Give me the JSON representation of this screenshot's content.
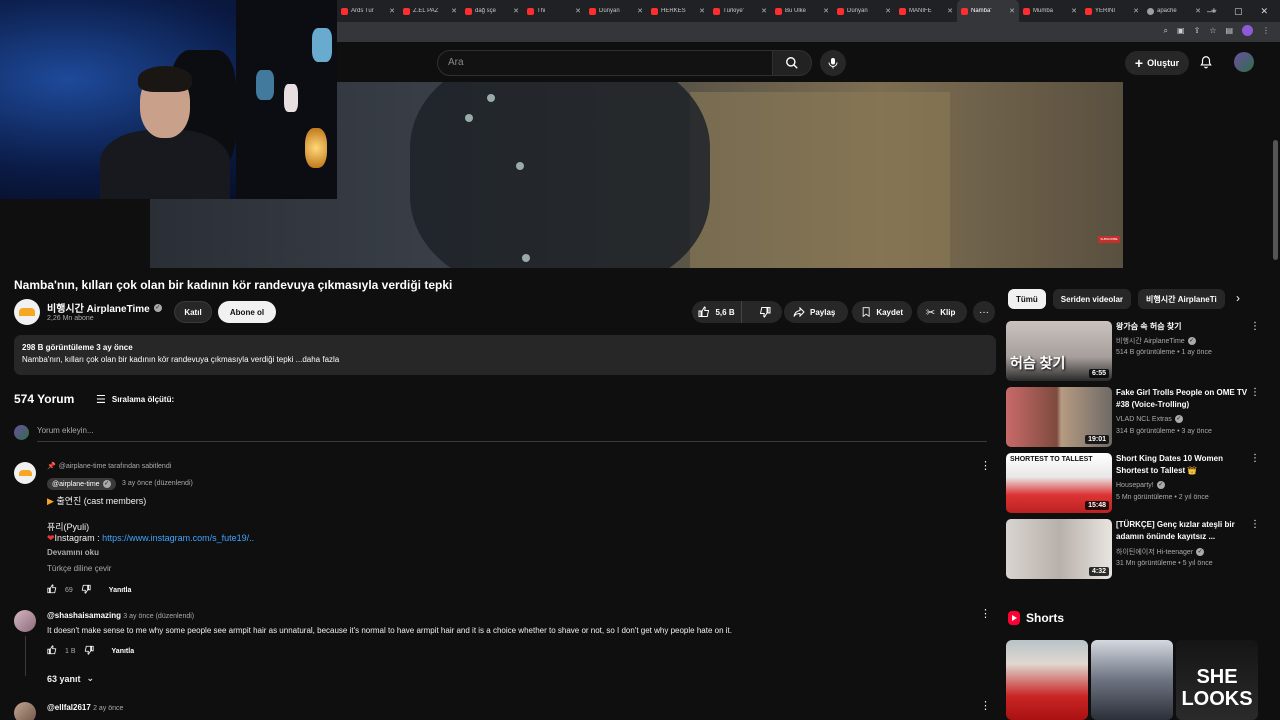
{
  "browser": {
    "tabs": [
      {
        "title": "Ards Tur",
        "active": false
      },
      {
        "title": "Z.EL PAZ",
        "active": false
      },
      {
        "title": "dağ sçe",
        "active": false
      },
      {
        "title": "Thi",
        "active": false
      },
      {
        "title": "Dünyan",
        "active": false
      },
      {
        "title": "HERKES",
        "active": false
      },
      {
        "title": "Türkiye'",
        "active": false
      },
      {
        "title": "Bu Ülke",
        "active": false
      },
      {
        "title": "Dünyan",
        "active": false
      },
      {
        "title": "MANIFE",
        "active": false
      },
      {
        "title": "Namba'",
        "active": true
      },
      {
        "title": "Mumba",
        "active": false
      },
      {
        "title": "YERİNİ",
        "active": false
      },
      {
        "title": "apache",
        "active": false
      }
    ],
    "new_tab": "+",
    "window_controls": [
      "—",
      "▢",
      "✕"
    ]
  },
  "header": {
    "search_placeholder": "Ara",
    "create_label": "Oluştur"
  },
  "video": {
    "title": "Namba'nın, kılları çok olan bir kadının kör randevuya çıkmasıyla verdiği tepki",
    "subscribe_badge": "SUBSCRIBE"
  },
  "channel": {
    "name": "비행시간 AirplaneTime",
    "subscribers": "2,26 Mn abone",
    "join_label": "Katıl",
    "subscribe_label": "Abone ol"
  },
  "actions": {
    "likes": "5,6 B",
    "share": "Paylaş",
    "save": "Kaydet",
    "clip": "Klip",
    "more": "···"
  },
  "description": {
    "meta": "298 B görüntüleme  3 ay önce",
    "text": "Namba'nın, kılları çok olan bir kadının kör randevuya çıkmasıyla verdiği tepki ...daha fazla"
  },
  "comments": {
    "count": "574 Yorum",
    "sort_label": "Sıralama ölçütü:",
    "add_placeholder": "Yorum ekleyin...",
    "items": [
      {
        "pinned": "@airplane-time tarafından sabitlendi",
        "author": "@airplane-time",
        "time": "3 ay önce (düzenlendi)",
        "line1": "출연진 (cast members)",
        "line2": "퓨리(Pyuli)",
        "line3_prefix": "Instagram : ",
        "line3_link": "https://www.instagram.com/s_fute19/..",
        "read_more": "Devamını oku",
        "translate": "Türkçe diline çevir",
        "likes": "69",
        "reply": "Yanıtla"
      },
      {
        "author": "@shashaisamazing",
        "time": "3 ay önce (düzenlendi)",
        "text": "It doesn't make sense to me why some people see armpit hair as unnatural, because it's normal to have armpit hair and it is a choice whether to shave or not, so I don't get why people hate on it.",
        "likes": "1 B",
        "reply": "Yanıtla",
        "replies": "63 yanıt"
      },
      {
        "author": "@ellfal2617",
        "time": "2 ay önce"
      }
    ]
  },
  "sidebar": {
    "chips": [
      "Tümü",
      "Seriden videolar",
      "비행시간 AirplaneTi"
    ],
    "recs": [
      {
        "title": "왕가슴 속 허슴 찾기",
        "channel": "비행시간 AirplaneTime",
        "meta": "514 B görüntüleme • 1 ay önce",
        "duration": "6:55",
        "thumb_caption": "허슴 찾기"
      },
      {
        "title": "Fake Girl Trolls People on OME TV #38 (Voice-Trolling)",
        "channel": "VLAD NCL Extras",
        "meta": "314 B görüntüleme • 3 ay önce",
        "duration": "19:01",
        "thumb_caption": ""
      },
      {
        "title": "Short King Dates 10 Women Shortest to Tallest 👑",
        "channel": "Houseparty!",
        "meta": "5 Mn görüntüleme • 2 yıl önce",
        "duration": "15:48",
        "thumb_caption": "SHORTEST TO TALLEST"
      },
      {
        "title": "[TÜRKÇE] Genç kızlar ateşli bir adamın önünde kayıtsız ...",
        "channel": "하이틴에이저 Hi-teenager",
        "meta": "31 Mn görüntüleme • 5 yıl önce",
        "duration": "4:32",
        "thumb_caption": ""
      }
    ],
    "shorts_heading": "Shorts",
    "short_caption": "SHE LOOKS"
  },
  "colors": {
    "background": "#0f0f0f",
    "link": "#3ea6ff",
    "youtube_red": "#ff0033"
  }
}
